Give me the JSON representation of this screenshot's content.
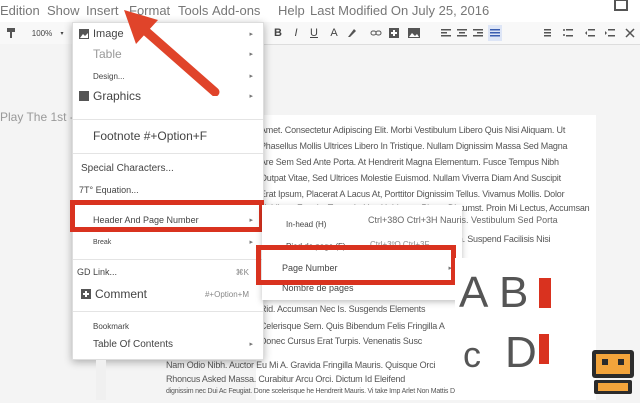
{
  "menubar": {
    "items": [
      "Edition",
      "Show",
      "Insert",
      "Format",
      "Tools",
      "Add-ons",
      "Help",
      "Last Modified On July 25, 2016"
    ]
  },
  "toolbar": {
    "zoom": "100%",
    "bold": "B",
    "italic": "I",
    "underline": "U",
    "text_color": "A"
  },
  "outline": {
    "title": "Play The 1st - Horizontal Line"
  },
  "insert_menu": {
    "items": [
      {
        "label": "Image",
        "arrow": "▸"
      },
      {
        "label": "Table",
        "arrow": "▸"
      },
      {
        "label": "Design...",
        "arrow": "▸"
      },
      {
        "label": "Graphics",
        "arrow": "▸"
      },
      {
        "label": "Footnote #+Option+F",
        "arrow": ""
      },
      {
        "label": "Special Characters...",
        "arrow": ""
      },
      {
        "label": "7T° Equation...",
        "arrow": ""
      },
      {
        "label": "Header And Page Number",
        "arrow": "▸"
      },
      {
        "label": "Break",
        "arrow": "▸"
      },
      {
        "label": "GD Link...",
        "shortcut": "⌘K"
      },
      {
        "label": "Comment",
        "shortcut": "#+Option+M"
      },
      {
        "label": "Bookmark",
        "arrow": ""
      },
      {
        "label": "Table Of Contents",
        "arrow": "▸"
      }
    ]
  },
  "submenu": {
    "items": [
      {
        "label": "In-head (H)",
        "shortcut": "Ctrl+38O Ctrl+3H Nauris. Vestibulum Sed Porta"
      },
      {
        "label": "Pied de page (F)",
        "shortcut": "Ctrl+3ºO Ctrl+3F"
      },
      {
        "label": "Page Number",
        "arrow": "▸"
      },
      {
        "label": "Nombre de pages",
        "arrow": ""
      }
    ]
  },
  "document": {
    "lines": [
      "Amet. Consectetur Adipiscing Elit. Morbi Vestibulum Libero Quis Nisi Aliquam. Ut",
      "Phasellus Mollis Ultrices Libero In Tristique. Nullam Dignissim Massa Sed Magna",
      "Are Sem Sed Ante Porta. At Hendrerit Magna Elementum. Fusce Tempus Nibh",
      "Outpat Vitae, Sed Ultrices Molestie Euismod. Nullam Viverra Diam And Suscipit",
      "Erat Ipsum, Placerat A Lacus At, Porttitor Dignissim Tellus. Vivamus Mollis. Dolor",
      "Ut Libero Feugiat Tortor. In Hac Habitasse Platea Dictumst. Proin Mi Lectus, Accumsan",
      "Eh. Suspend Facilisis Nisi",
      "Rid. Accumsan Nec Is. Susgends Elements",
      "Celerisque Sem. Quis Bibendum Felis Fringilla A",
      "Donec Cursus Erat Turpis. Venenatis Susc",
      "Nam Odio Nibh. Auctor Eu Mi A. Gravida Fringilla Mauris. Quisque Orci",
      "Rhoncus Asked Massa. Curabitur Arcu Orci. Dictum Id Eleifend",
      "dignissim nec  Dui Ac Feugiat. Done  scelerisque he  Hendrerit Mauris. Vi  take Imp Arlet Non Mattis Does Nor"
    ]
  },
  "preview": {
    "letters": [
      "A",
      "B",
      "c",
      "D"
    ]
  },
  "colors": {
    "highlight": "#d9321f",
    "arrow": "#e0442a"
  }
}
